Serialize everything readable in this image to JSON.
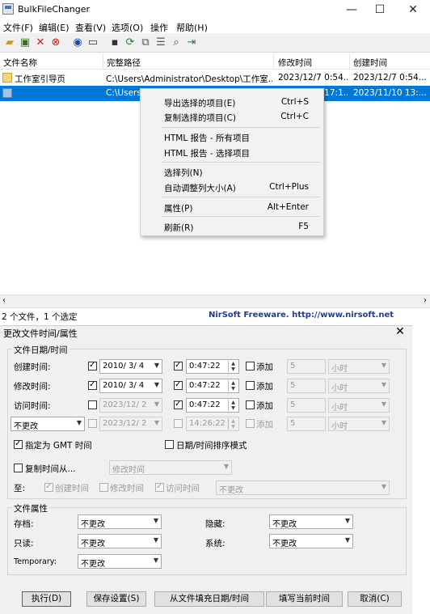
{
  "app": {
    "title": "BulkFileChanger"
  },
  "window_controls": {
    "minimize": "—",
    "maximize": "☐",
    "close": "✕"
  },
  "menu": [
    "文件(F)",
    "编辑(E)",
    "查看(V)",
    "选项(O)",
    "操作",
    "帮助(H)"
  ],
  "list": {
    "columns": [
      "文件名称",
      "完整路径",
      "修改时间",
      "创建时间"
    ],
    "rows": [
      {
        "name": "工作室引导页",
        "path": "C:\\Users\\Administrator\\Desktop\\工作室...",
        "modified": "2023/12/7 0:54...",
        "created": "2023/12/7 0:54..."
      },
      {
        "name": "",
        "path": "C:\\Users\\",
        "modified": "2023/12/2 17:1...",
        "created": "2023/11/10 13:..."
      }
    ]
  },
  "context_menu": [
    {
      "label": "导出选择的项目(E)",
      "shortcut": "Ctrl+S"
    },
    {
      "label": "复制选择的项目(C)",
      "shortcut": "Ctrl+C"
    },
    {
      "label": "HTML 报告 - 所有项目",
      "shortcut": ""
    },
    {
      "label": "HTML 报告 - 选择项目",
      "shortcut": ""
    },
    {
      "label": "选择列(N)",
      "shortcut": ""
    },
    {
      "label": "自动调整列大小(A)",
      "shortcut": "Ctrl+Plus"
    },
    {
      "label": "属性(P)",
      "shortcut": "Alt+Enter"
    },
    {
      "label": "刷新(R)",
      "shortcut": "F5"
    }
  ],
  "status": {
    "count": "2 个文件，1 个选定",
    "credit": "NirSoft Freeware.  http://www.nirsoft.net"
  },
  "dialog": {
    "title": "更改文件时间/属性",
    "date_group": "文件日期/时间",
    "rows": [
      {
        "label": "创建时间:",
        "date": "2010/ 3/ 4",
        "time": "0:47:22",
        "add_label": "添加",
        "add_value": "5",
        "unit": "小时"
      },
      {
        "label": "修改时间:",
        "date": "2010/ 3/ 4",
        "time": "0:47:22",
        "add_label": "添加",
        "add_value": "5",
        "unit": "小时"
      },
      {
        "label": "访问时间:",
        "date": "2023/12/ 2",
        "time": "0:47:22",
        "add_label": "添加",
        "add_value": "5",
        "unit": "小时"
      }
    ],
    "extra_row": {
      "select": "不更改",
      "date": "2023/12/ 2",
      "time": "14:26:22",
      "add_label": "添加",
      "add_value": "5",
      "unit": "小时"
    },
    "gmt_label": "指定为 GMT 时间",
    "sort_label": "日期/时间排序模式",
    "copy_label": "复制时间从...",
    "copy_select": "修改时间",
    "to_label": "至:",
    "to_created": "创建时间",
    "to_modified": "修改时间",
    "to_accessed": "访问时间",
    "to_select": "不更改",
    "attr_group": "文件属性",
    "attrs": [
      {
        "label": "存档:",
        "value": "不更改"
      },
      {
        "label": "只读:",
        "value": "不更改"
      },
      {
        "label": "Temporary:",
        "value": "不更改"
      },
      {
        "label": "隐藏:",
        "value": "不更改"
      },
      {
        "label": "系统:",
        "value": "不更改"
      }
    ],
    "buttons": {
      "execute": "执行(D)",
      "save": "保存设置(S)",
      "fill": "从文件填充日期/时间",
      "now": "填写当前时间",
      "cancel": "取消(C)"
    }
  }
}
